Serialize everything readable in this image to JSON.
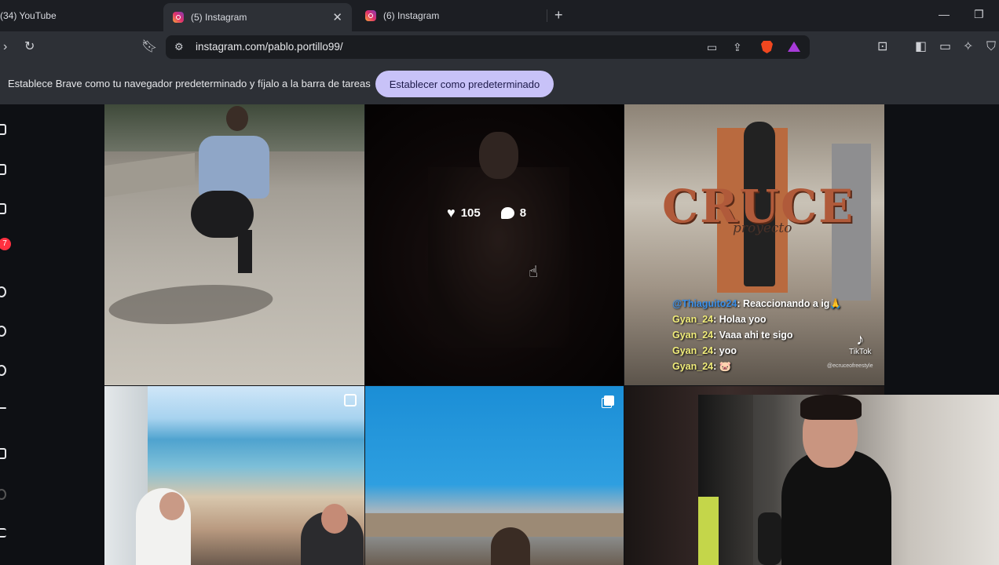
{
  "tabs": [
    {
      "title": "(34) YouTube",
      "active": false
    },
    {
      "title": "(5) Instagram",
      "active": true
    },
    {
      "title": "(6) Instagram",
      "active": false
    }
  ],
  "address": {
    "url": "instagram.com/pablo.portillo99/"
  },
  "infobar": {
    "message": "Establece Brave como tu navegador predeterminado y fíjalo a la barra de tareas",
    "button_label": "Establecer como predeterminado"
  },
  "nav": {
    "notifications_badge": "7"
  },
  "posts": {
    "hovered": {
      "likes": "105",
      "comments": "8"
    },
    "cruce": {
      "title": "CRUCE",
      "subtitle": "proyecto",
      "chat": [
        {
          "user": "@Thiaguito24",
          "text": "Reaccionando a ig🙏"
        },
        {
          "user": "Gyan_24",
          "text": "Holaa yoo"
        },
        {
          "user": "Gyan_24",
          "text": "Vaaa ahi te sigo"
        },
        {
          "user": "Gyan_24",
          "text": "yoo"
        },
        {
          "user": "Gyan_24",
          "text": "🐷"
        }
      ],
      "tiktok_label": "TikTok",
      "watermark": "@ecruceofreestyle"
    }
  },
  "icons": {
    "reload": "reload-icon",
    "bookmark": "bookmark-icon",
    "brave": "brave-shield-icon"
  }
}
